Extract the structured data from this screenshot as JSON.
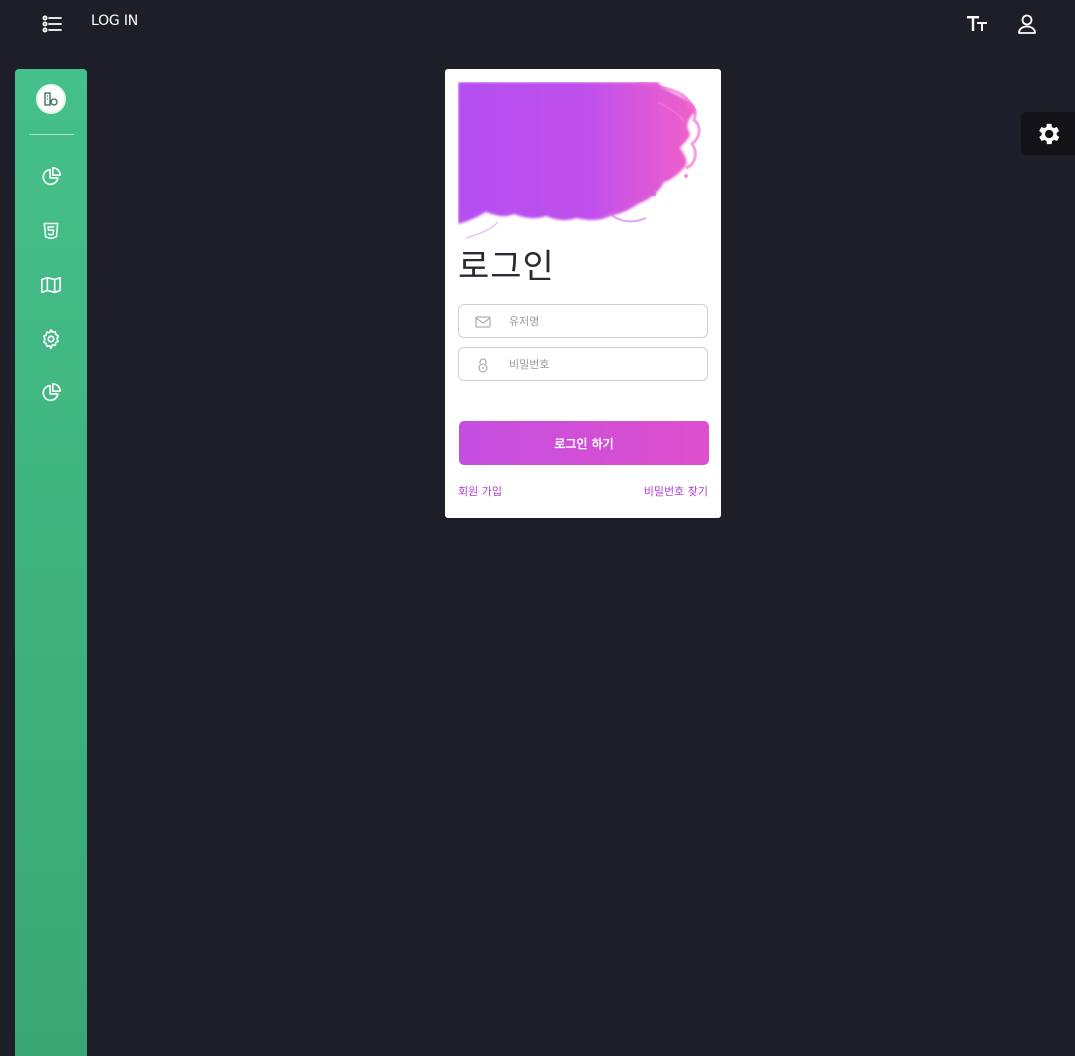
{
  "header": {
    "page_label": "LOG IN",
    "menu_icon": "list-icon",
    "font_size_icon": "text-size-icon",
    "user_icon": "user-icon"
  },
  "sidebar": {
    "logo_icon": "building-logo-icon",
    "accent_color": "#45c08a",
    "items": [
      {
        "icon": "pie-chart-icon"
      },
      {
        "icon": "html5-icon"
      },
      {
        "icon": "map-icon"
      },
      {
        "icon": "gear-icon"
      },
      {
        "icon": "pie-chart-icon"
      }
    ]
  },
  "settings_fab": {
    "icon": "gear-icon"
  },
  "login": {
    "title": "로그인",
    "username_placeholder": "유저명",
    "password_placeholder": "비밀번호",
    "submit_label": "로그인 하기",
    "signup_link": "회원 가입",
    "find_password_link": "비밀번호 찾기",
    "accent_color": "#c94fdc"
  }
}
